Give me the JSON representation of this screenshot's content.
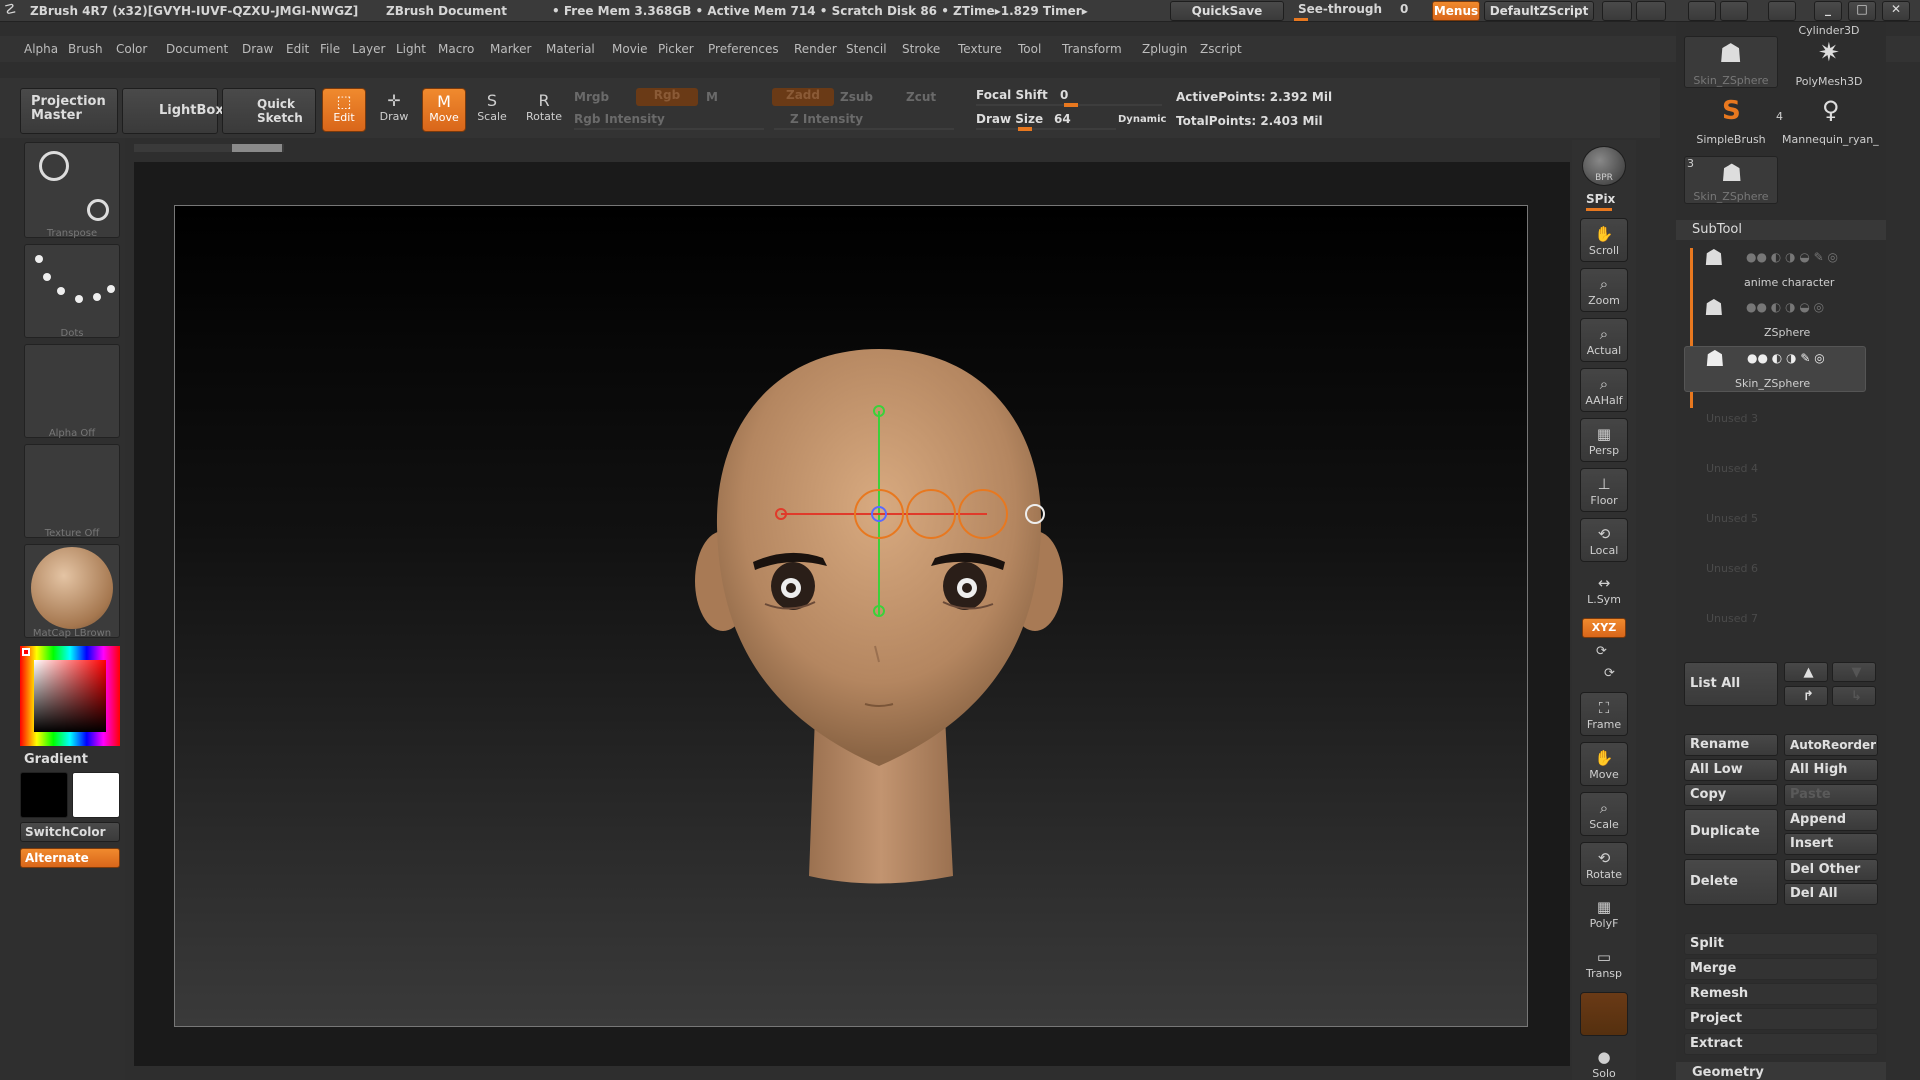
{
  "titlebar": {
    "app": "ZBrush 4R7 (x32)[GVYH-IUVF-QZXU-JMGI-NWGZ]",
    "doc": "ZBrush Document",
    "mem": "• Free Mem 3.368GB • Active Mem 714 • Scratch Disk 86 • ZTime▸1.829 Timer▸",
    "quicksave": "QuickSave",
    "seethrough": "See-through",
    "seethrough_val": "0",
    "menus": "Menus",
    "script": "DefaultZScript"
  },
  "menubar": [
    "Alpha",
    "Brush",
    "Color",
    "Document",
    "Draw",
    "Edit",
    "File",
    "Layer",
    "Light",
    "Macro",
    "Marker",
    "Material",
    "Movie",
    "Picker",
    "Preferences",
    "Render",
    "Stencil",
    "Stroke",
    "Texture",
    "Tool",
    "Transform",
    "Zplugin",
    "Zscript"
  ],
  "toprow": {
    "projection": "Projection Master",
    "lightbox": "LightBox",
    "quicksketch": "Quick Sketch",
    "edit": "Edit",
    "draw": "Draw",
    "move": "Move",
    "scale": "Scale",
    "rotate": "Rotate",
    "mrgb": "Mrgb",
    "rgb": "Rgb",
    "m": "M",
    "rgb_intensity": "Rgb Intensity",
    "zadd": "Zadd",
    "zsub": "Zsub",
    "zcut": "Zcut",
    "z_intensity": "Z Intensity",
    "focal_shift_label": "Focal Shift",
    "focal_shift_val": "0",
    "draw_size_label": "Draw Size",
    "draw_size_val": "64",
    "dynamic": "Dynamic",
    "active_points": "ActivePoints: 2.392 Mil",
    "total_points": "TotalPoints: 2.403 Mil"
  },
  "leftpanel": {
    "transpose": "Transpose",
    "dots": "Dots",
    "alpha": "Alpha Off",
    "texture": "Texture Off",
    "matcap": "MatCap LBrown",
    "gradient": "Gradient",
    "switchcolor": "SwitchColor",
    "alternate": "Alternate"
  },
  "rightshelf": [
    "BPR",
    "SPix",
    "Scroll",
    "Zoom",
    "Actual",
    "AAHalf",
    "Persp",
    "Floor",
    "Local",
    "L.Sym",
    "XYZ",
    "Frame",
    "Move",
    "Scale",
    "Rotate",
    "PolyF",
    "Transp",
    "Solo"
  ],
  "toolpanel": {
    "tools": [
      {
        "label": "Skin_ZSphere"
      },
      {
        "label": "PolyMesh3D"
      },
      {
        "label": "Cylinder3D"
      },
      {
        "label": "SimpleBrush"
      },
      {
        "label": "Mannequin_ryan_"
      },
      {
        "label": "Skin_ZSphere"
      }
    ],
    "tool_count_a": "4",
    "tool_count_b": "3",
    "subtool_title": "SubTool",
    "subtools": [
      {
        "label": "anime character"
      },
      {
        "label": "ZSphere"
      },
      {
        "label": "Skin_ZSphere"
      }
    ],
    "unused": [
      "Unused 3",
      "Unused 4",
      "Unused 5",
      "Unused 6",
      "Unused 7"
    ],
    "list_all": "List All",
    "buttons": {
      "rename": "Rename",
      "autoreorder": "AutoReorder",
      "alllow": "All Low",
      "allhigh": "All High",
      "copy": "Copy",
      "paste": "Paste",
      "duplicate": "Duplicate",
      "append": "Append",
      "insert": "Insert",
      "delete": "Delete",
      "delother": "Del Other",
      "delall": "Del All",
      "split": "Split",
      "merge": "Merge",
      "remesh": "Remesh",
      "project": "Project",
      "extract": "Extract",
      "geometry": "Geometry"
    }
  },
  "colors": {
    "accent": "#e8781f",
    "skin": "#c69a72"
  }
}
